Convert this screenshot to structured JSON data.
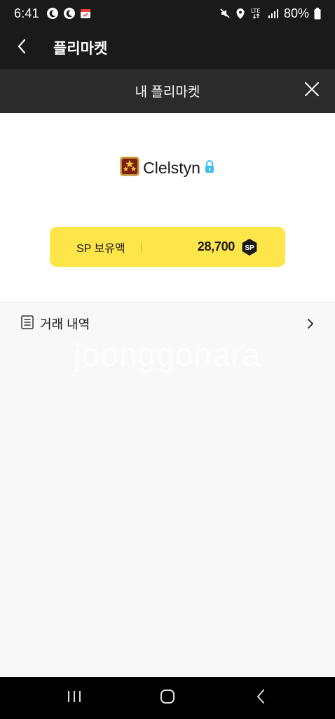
{
  "status_bar": {
    "time": "6:41",
    "battery_text": "80%",
    "left_icons": [
      "moon-notification-icon",
      "moon-notification-icon",
      "calendar-notification-icon"
    ],
    "right_icons": [
      "mute-icon",
      "location-icon",
      "lte-icon",
      "signal-icon",
      "battery-icon"
    ],
    "lte_label": "LTE"
  },
  "app_bar": {
    "title": "플리마켓",
    "back_icon": "chevron-left-icon"
  },
  "modal": {
    "title": "내 플리마켓",
    "close_icon": "close-icon"
  },
  "profile": {
    "username": "Clelstyn",
    "rank_icon": "three-star-rank-icon",
    "lock_icon": "lock-icon"
  },
  "sp_card": {
    "label": "SP 보유액",
    "amount": "28,700",
    "badge_text": "SP",
    "background": "#fee54a"
  },
  "history": {
    "label": "거래 내역",
    "icon": "document-list-icon",
    "chevron": "chevron-right-icon"
  },
  "watermark": "joonggonara",
  "nav_bar": {
    "icons": [
      "recent-apps-icon",
      "home-icon",
      "back-icon"
    ]
  },
  "colors": {
    "header_dark": "#1a1a1a",
    "modal_header": "#2b2b2b",
    "accent_yellow": "#fee54a",
    "lock_blue": "#3cc0f0"
  }
}
